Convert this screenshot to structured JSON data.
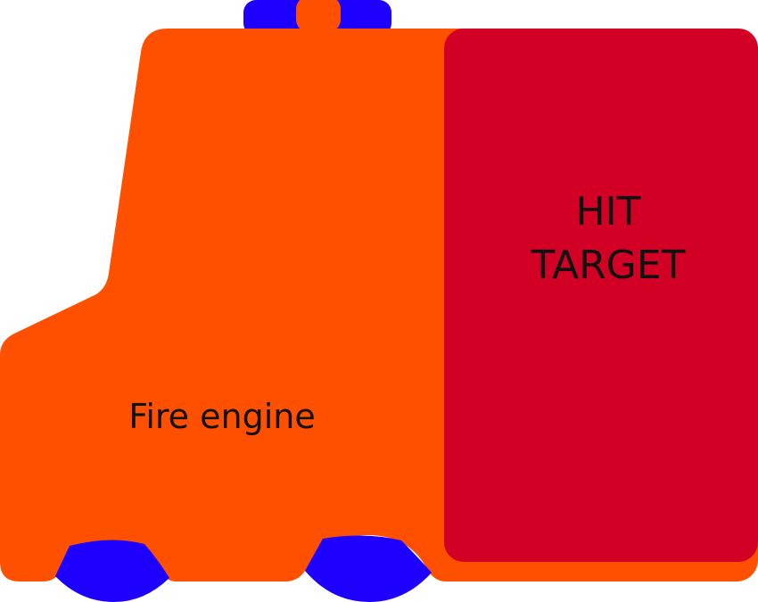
{
  "body_label": "Fire engine",
  "hit_target": {
    "line1": "HIT",
    "line2": "TARGET"
  },
  "colors": {
    "body": "#ff5000",
    "hit_target": "#d10024",
    "wheels": "#1e00ff",
    "siren": "#1e00ff",
    "siren_center": "#ff5000",
    "text": "#111111"
  }
}
